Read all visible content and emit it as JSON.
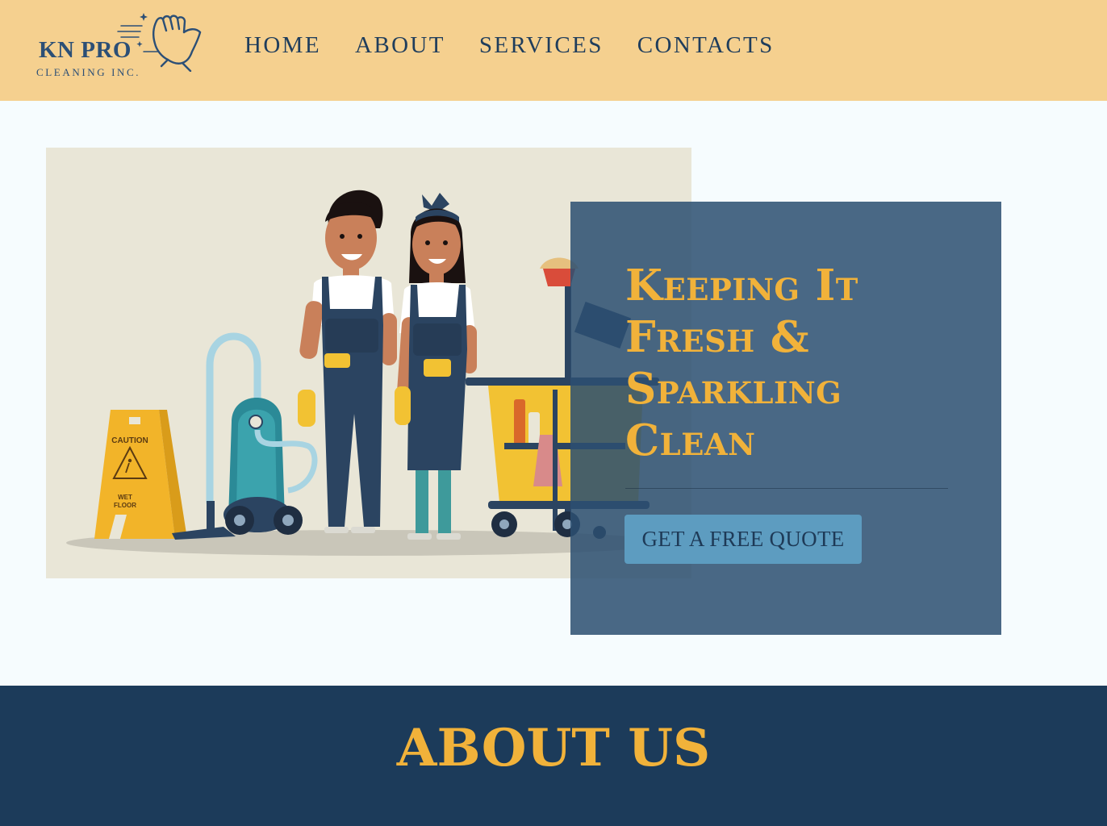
{
  "brand": {
    "name": "KN PRO",
    "tagline": "CLEANING INC."
  },
  "nav": {
    "items": [
      {
        "label": "HOME"
      },
      {
        "label": "ABOUT"
      },
      {
        "label": "SERVICES"
      },
      {
        "label": "CONTACTS"
      }
    ]
  },
  "hero": {
    "headline": "Keeping It Fresh & Sparkling Clean",
    "cta_label": "GET A FREE QUOTE",
    "illustration": {
      "sign_line1": "CAUTION",
      "sign_line2": "WET",
      "sign_line3": "FLOOR"
    }
  },
  "about": {
    "title": "ABOUT US"
  },
  "colors": {
    "header_bg": "#f5d08f",
    "nav_text": "#1f3d5c",
    "accent_gold": "#f1b23a",
    "overlay_bg": "#2c4f71",
    "cta_bg": "#5d9cc0",
    "about_bg": "#1c3b5a"
  }
}
